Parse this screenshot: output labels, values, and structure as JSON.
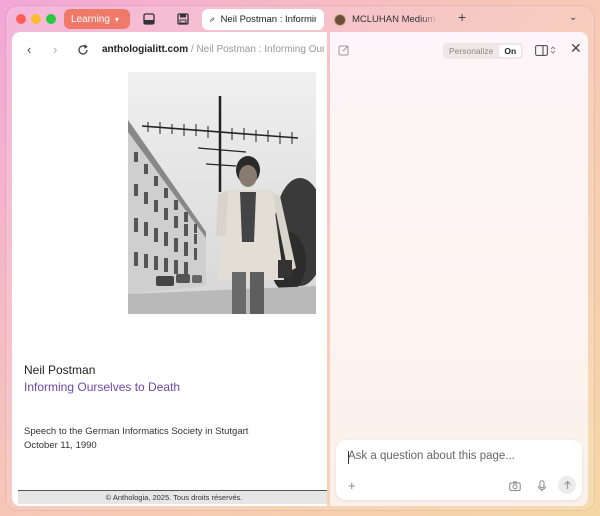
{
  "tabbar": {
    "space_label": "Learning",
    "tabs": [
      {
        "title": "Neil Postman : Informing Ourselves to Death",
        "active": true
      },
      {
        "title": "MCLUHAN Medium is the Message",
        "active": false
      }
    ]
  },
  "page": {
    "url_host": "anthologialitt.com",
    "url_rest": " / Neil Postman : Informing Our...",
    "name": "Neil Postman",
    "subtitle": "Informing Ourselves to Death",
    "speech": "Speech to the German Informatics Society in Stutgart",
    "date": "October 11, 1990",
    "footer": "© Anthologia, 2025. Tous droits réservés."
  },
  "assistant": {
    "personalize_label": "Personalize",
    "personalize_state": "On",
    "ask_placeholder": "Ask a question about this page..."
  },
  "colors": {
    "space_pill": "#f07a6a",
    "link_purple": "#6b4aa8"
  }
}
